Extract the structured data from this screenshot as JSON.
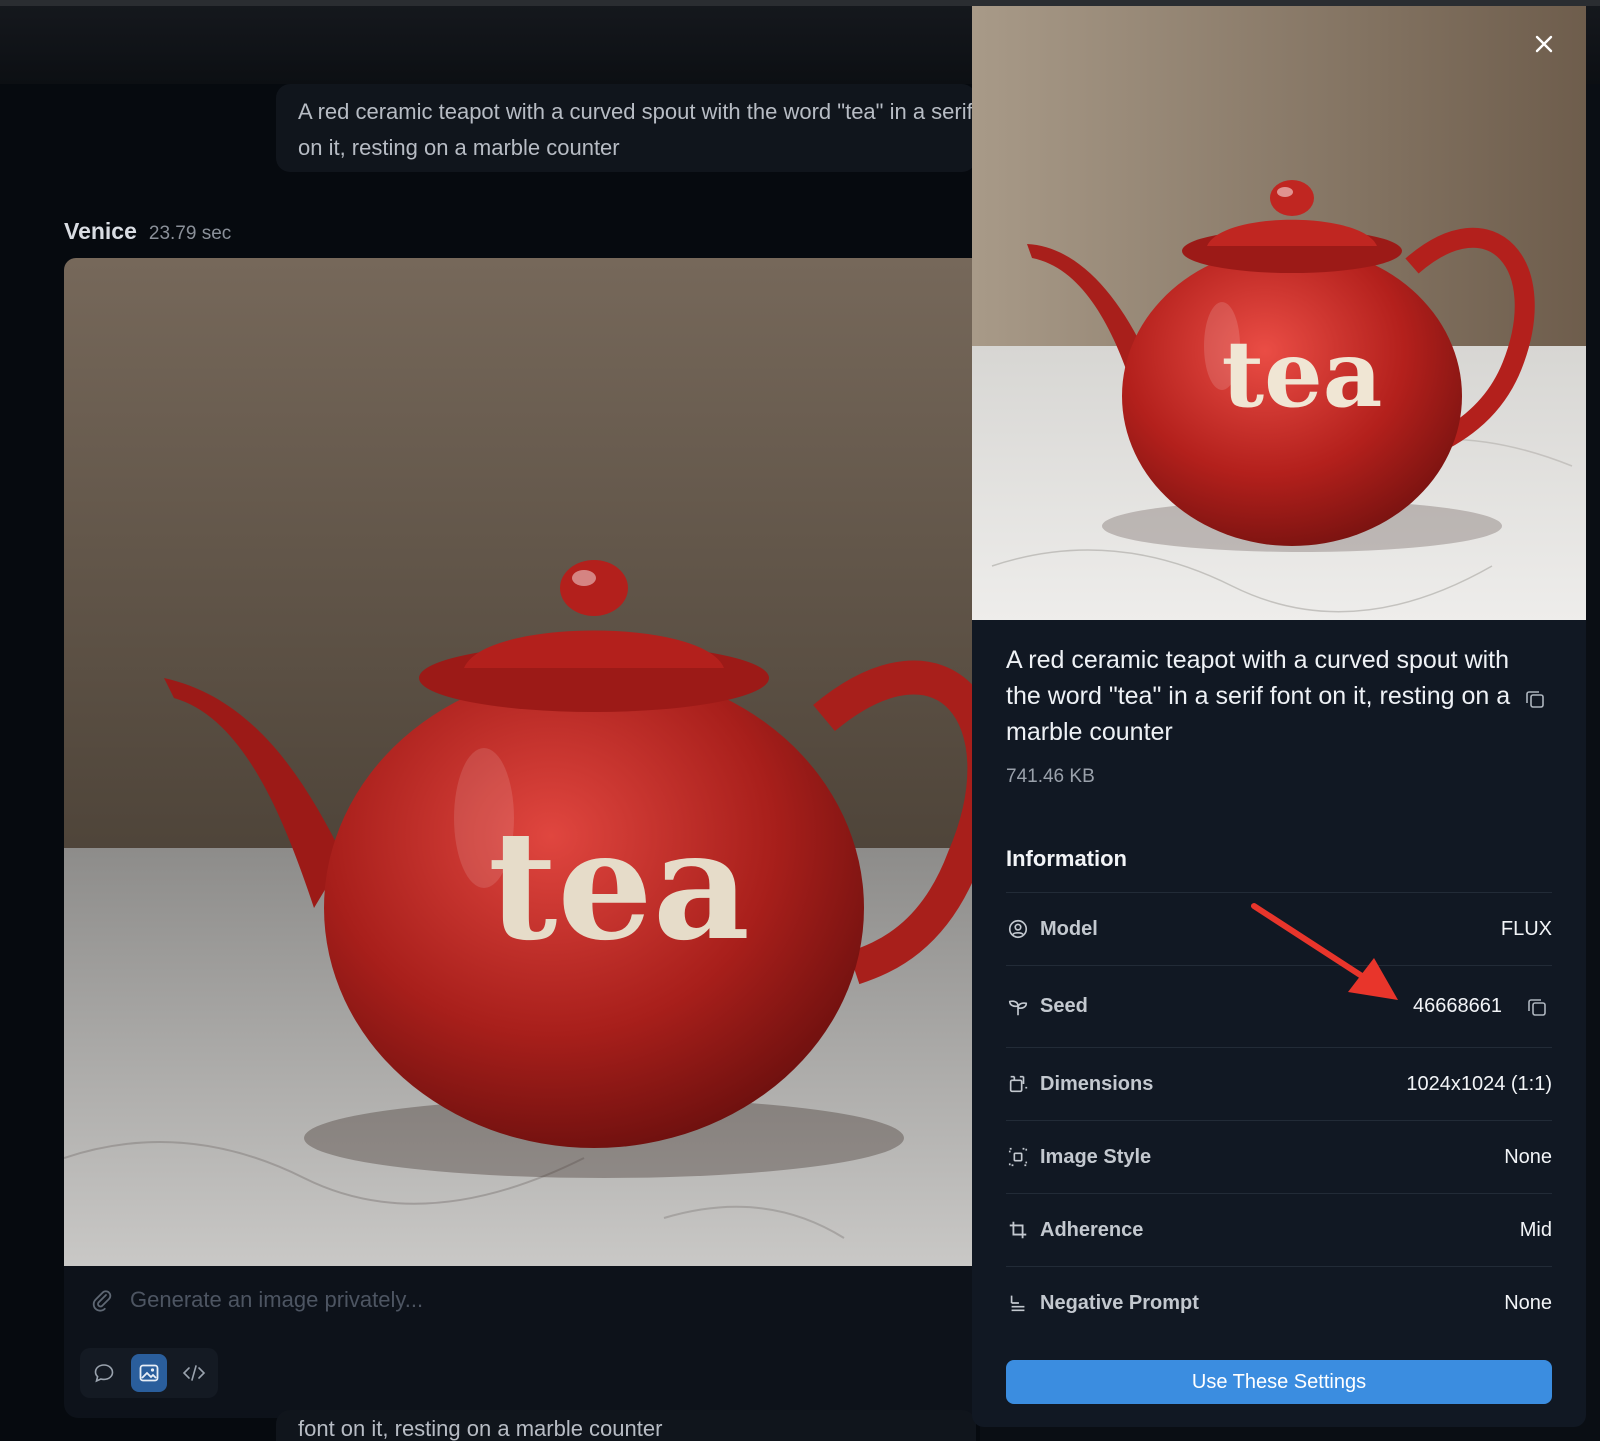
{
  "chat": {
    "user_prompt": "A red ceramic teapot with a curved spout with the word \"tea\" in a serif font on it, resting on a marble counter",
    "sender_name": "Venice",
    "response_time": "23.79 sec",
    "image_word": "tea",
    "partial_text": "font on it, resting on a marble counter"
  },
  "composer": {
    "placeholder": "Generate an image privately...",
    "icons": [
      "paperclip-icon",
      "chat-bubble-icon",
      "image-icon",
      "code-icon"
    ],
    "active_mode": "image"
  },
  "panel": {
    "image_word": "tea",
    "prompt": "A red ceramic teapot with a curved spout with the word \"tea\" in a serif font on it, resting on a marble counter",
    "file_size": "741.46 KB",
    "info_title": "Information",
    "rows": [
      {
        "label": "Model",
        "value": "FLUX",
        "icon": "user-circle-icon"
      },
      {
        "label": "Seed",
        "value": "46668661",
        "icon": "sprout-icon"
      },
      {
        "label": "Dimensions",
        "value": "1024x1024 (1:1)",
        "icon": "crop-frame-icon"
      },
      {
        "label": "Image Style",
        "value": "None",
        "icon": "focus-icon"
      },
      {
        "label": "Adherence",
        "value": "Mid",
        "icon": "crop-icon"
      },
      {
        "label": "Negative Prompt",
        "value": "None",
        "icon": "text-align-icon"
      }
    ],
    "button_label": "Use These Settings"
  },
  "colors": {
    "accent": "#3b8de0",
    "panel_bg": "#111823",
    "teapot_red": "#b3201c",
    "annotation_arrow": "#e8352b"
  }
}
